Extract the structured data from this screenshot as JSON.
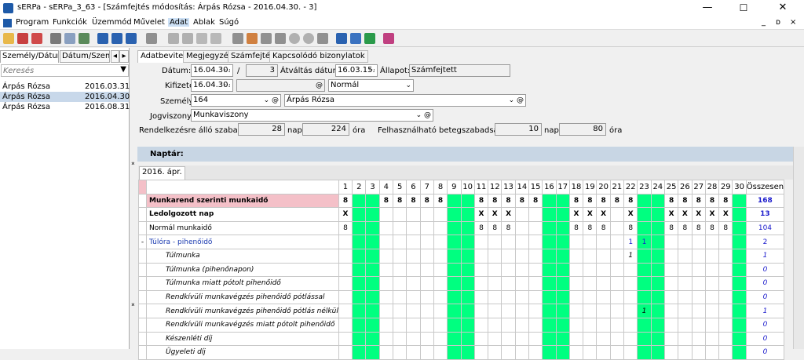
{
  "window": {
    "title": "sERPa - sERPa_3_63 - [Számfejtés módosítás: Árpás Rózsa - 2016.04.30. - 3]",
    "min": "—",
    "max": "☐",
    "close": "✕"
  },
  "menu": [
    "Program",
    "Funkciók",
    "Üzemmód",
    "Művelet",
    "Adat",
    "Ablak",
    "Súgó"
  ],
  "mdi": {
    "min": "_",
    "restore": "ᴅ",
    "close": "×"
  },
  "left": {
    "tabs": [
      "Személy/Dátum",
      "Dátum/Személ"
    ],
    "search_placeholder": "Keresés",
    "rows": [
      {
        "name": "Árpás Rózsa",
        "date": "2016.03.31"
      },
      {
        "name": "Árpás Rózsa",
        "date": "2016.04.30"
      },
      {
        "name": "Árpás Rózsa",
        "date": "2016.08.31"
      }
    ]
  },
  "tabs": [
    "Adatbevitel",
    "Megjegyzés",
    "Számfejtés",
    "Kapcsolódó bizonylatok"
  ],
  "form": {
    "datum_label": "Dátum:",
    "datum": "16.04.30.",
    "slash": "/",
    "sorszam": "3",
    "atvaltas_label": "Átváltás dátum:",
    "atvaltas": "16.03.15.",
    "allapot_label": "Állapot:",
    "allapot": "Számfejtett",
    "kifizetes_label": "Kifizetés:",
    "kifizetes": "16.04.30.",
    "mod": "Normál",
    "szemely_label": "Személy:",
    "szemely_kod": "164",
    "szemely_nev": "Árpás Rózsa",
    "jogviszony_label": "Jogviszony:",
    "jogviszony": "Munkaviszony",
    "rend_label": "Rendelkezésre álló szabadság:",
    "rend_nap": "28",
    "nap": "nap",
    "rend_ora": "224",
    "ora": "óra",
    "beteg_label": "Felhasználható betegszabadság:",
    "beteg_nap": "10",
    "beteg_ora": "80"
  },
  "naptar": {
    "title": "Naptár:",
    "tab": "2016. ápr.",
    "total_label": "Összesen"
  },
  "colors": {
    "weekend": "#00ff80",
    "header": "#c8d6e4",
    "pink": "#f4c0c8"
  },
  "days": [
    "1",
    "2",
    "3",
    "4",
    "5",
    "6",
    "7",
    "8",
    "9",
    "10",
    "11",
    "12",
    "13",
    "14",
    "15",
    "16",
    "17",
    "18",
    "19",
    "20",
    "21",
    "22",
    "23",
    "24",
    "25",
    "26",
    "27",
    "28",
    "29",
    "30"
  ],
  "weekend_days": [
    2,
    3,
    9,
    10,
    16,
    17,
    23,
    24,
    30
  ],
  "rows": [
    {
      "label": "Munkarend szerinti munkaidő",
      "style": "pinkbold",
      "cells": {
        "1": "8",
        "4": "8",
        "5": "8",
        "6": "8",
        "7": "8",
        "8": "8",
        "11": "8",
        "12": "8",
        "13": "8",
        "14": "8",
        "15": "8",
        "18": "8",
        "19": "8",
        "20": "8",
        "21": "8",
        "22": "8",
        "25": "8",
        "26": "8",
        "27": "8",
        "28": "8",
        "29": "8"
      },
      "total": "168"
    },
    {
      "label": "Ledolgozott nap",
      "style": "bold",
      "cells": {
        "1": "X",
        "11": "X",
        "12": "X",
        "13": "X",
        "18": "X",
        "19": "X",
        "20": "X",
        "22": "X",
        "25": "X",
        "26": "X",
        "27": "X",
        "28": "X",
        "29": "X"
      },
      "total": "13"
    },
    {
      "label": "Normál munkaidő",
      "style": "normal",
      "cells": {
        "1": "8",
        "11": "8",
        "12": "8",
        "13": "8",
        "18": "8",
        "19": "8",
        "20": "8",
        "22": "8",
        "25": "8",
        "26": "8",
        "27": "8",
        "28": "8",
        "29": "8"
      },
      "total": "104"
    },
    {
      "label": "Túlóra - pihenőidő",
      "prefix": "-",
      "style": "blue",
      "cells": {
        "22": "1",
        "23": "1"
      },
      "total": "2"
    },
    {
      "label": "Túlmunka",
      "style": "italic",
      "cells": {
        "22": "1"
      },
      "total": "1"
    },
    {
      "label": "Túlmunka (pihenőnapon)",
      "style": "italic",
      "cells": {},
      "total": "0"
    },
    {
      "label": "Túlmunka miatt pótolt pihenőidő",
      "style": "italic",
      "cells": {},
      "total": "0"
    },
    {
      "label": "Rendkívüli munkavégzés pihenőidő pótlással",
      "style": "italic",
      "cells": {},
      "total": "0"
    },
    {
      "label": "Rendkívüli munkavégzés pihenőidő pótlás nélkül",
      "style": "italic",
      "cells": {
        "23": "1"
      },
      "total": "1"
    },
    {
      "label": "Rendkívüli munkavégzés miatt pótolt pihenőidő",
      "style": "italic",
      "cells": {},
      "total": "0"
    },
    {
      "label": "Készenléti díj",
      "style": "italic",
      "cells": {},
      "total": "0"
    },
    {
      "label": "Ügyeleti díj",
      "style": "italic",
      "cells": {},
      "total": "0"
    }
  ]
}
